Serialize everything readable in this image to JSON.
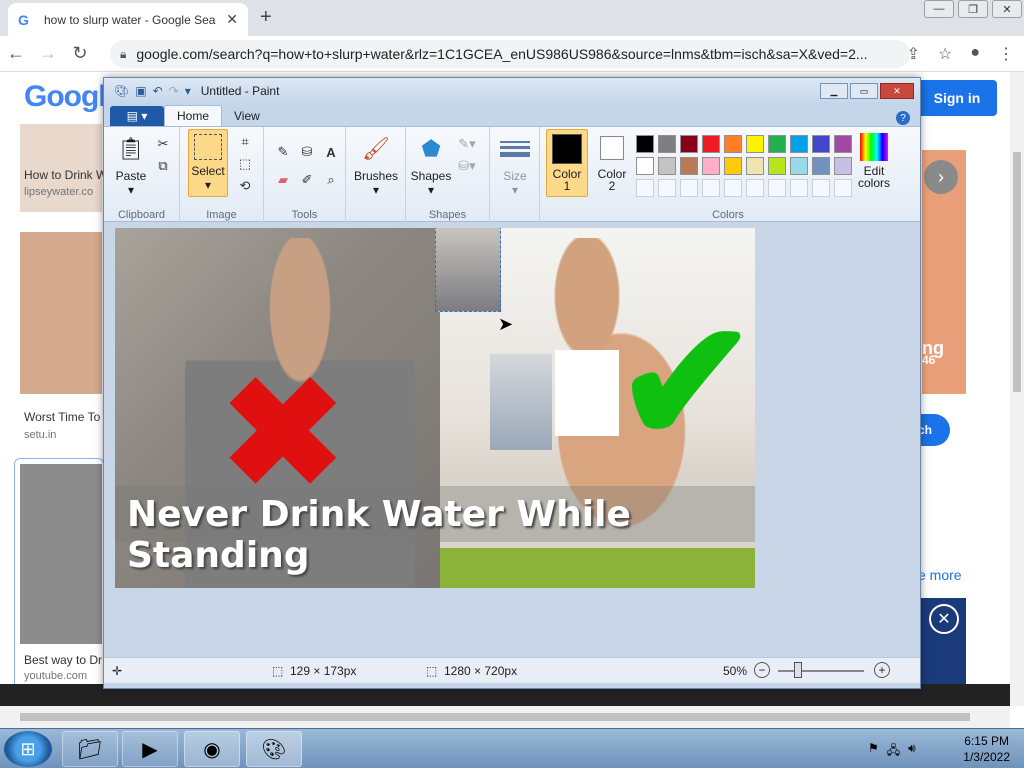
{
  "browser": {
    "tab_title": "how to slurp water - Google Sea",
    "url": "google.com/search?q=how+to+slurp+water&rlz=1C1GCEA_enUS986US986&source=lnms&tbm=isch&sa=X&ved=2...",
    "new_tab": "+",
    "tab_close": "✕"
  },
  "google": {
    "logo": "Googl",
    "sign_in": "Sign in",
    "results": [
      {
        "title": "How to Drink W",
        "source": "lipseywater.co"
      },
      {
        "title": "Worst Time To",
        "source": "setu.in"
      },
      {
        "title": "Best way to Dr",
        "source": "youtube.com"
      }
    ],
    "right_snippet": "e more",
    "right_badge": "ng",
    "right_badge2": "46",
    "right_btn": "ch"
  },
  "paint": {
    "title": "Untitled - Paint",
    "file_tab": "▤ ▾",
    "tabs": [
      "Home",
      "View"
    ],
    "groups": {
      "clipboard": "Clipboard",
      "image": "Image",
      "tools": "Tools",
      "shapes": "Shapes",
      "colors": "Colors"
    },
    "buttons": {
      "paste": "Paste",
      "select": "Select",
      "brushes": "Brushes",
      "shapes": "Shapes",
      "size": "Size",
      "color1": "Color 1",
      "color2": "Color 2",
      "edit_colors": "Edit colors"
    },
    "banner": "Never Drink Water While Standing",
    "status": {
      "selection": "129 × 173px",
      "image_size": "1280 × 720px",
      "zoom": "50%"
    }
  },
  "palette": {
    "row1": [
      "#000000",
      "#7f7f7f",
      "#880015",
      "#ed1c24",
      "#ff7f27",
      "#fff200",
      "#22b14c",
      "#00a2e8",
      "#3f48cc",
      "#a349a4"
    ],
    "row2": [
      "#ffffff",
      "#c3c3c3",
      "#b97a57",
      "#ffaec9",
      "#ffc90e",
      "#efe4b0",
      "#b5e61d",
      "#99d9ea",
      "#7092be",
      "#c8bfe7"
    ]
  },
  "taskbar": {
    "time": "6:15 PM",
    "date": "1/3/2022"
  }
}
